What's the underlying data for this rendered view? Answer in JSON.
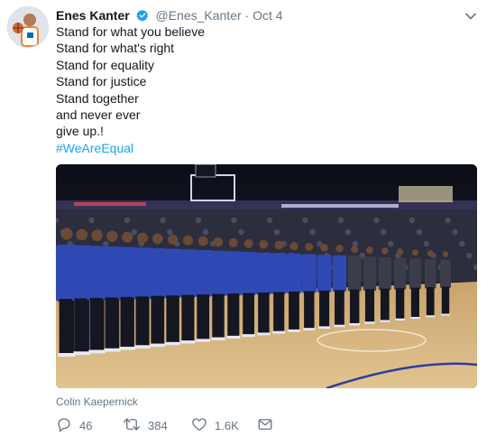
{
  "tweet": {
    "author_name": "Enes Kanter",
    "handle": "@Enes_Kanter",
    "separator": "·",
    "date": "Oct 4",
    "verified_icon": "verified-badge-icon",
    "lines": [
      "Stand for what you believe",
      "Stand for what's right",
      "Stand for equality",
      "Stand for justice",
      "Stand together",
      "and never ever",
      "give up.!"
    ],
    "hashtag": "#WeAreEqual",
    "media_caption": "Colin Kaepernick",
    "actions": {
      "reply_count": "46",
      "retweet_count": "384",
      "like_count": "1.6K"
    }
  },
  "colors": {
    "link": "#1da1f2",
    "muted": "#657786",
    "text": "#14171a"
  }
}
